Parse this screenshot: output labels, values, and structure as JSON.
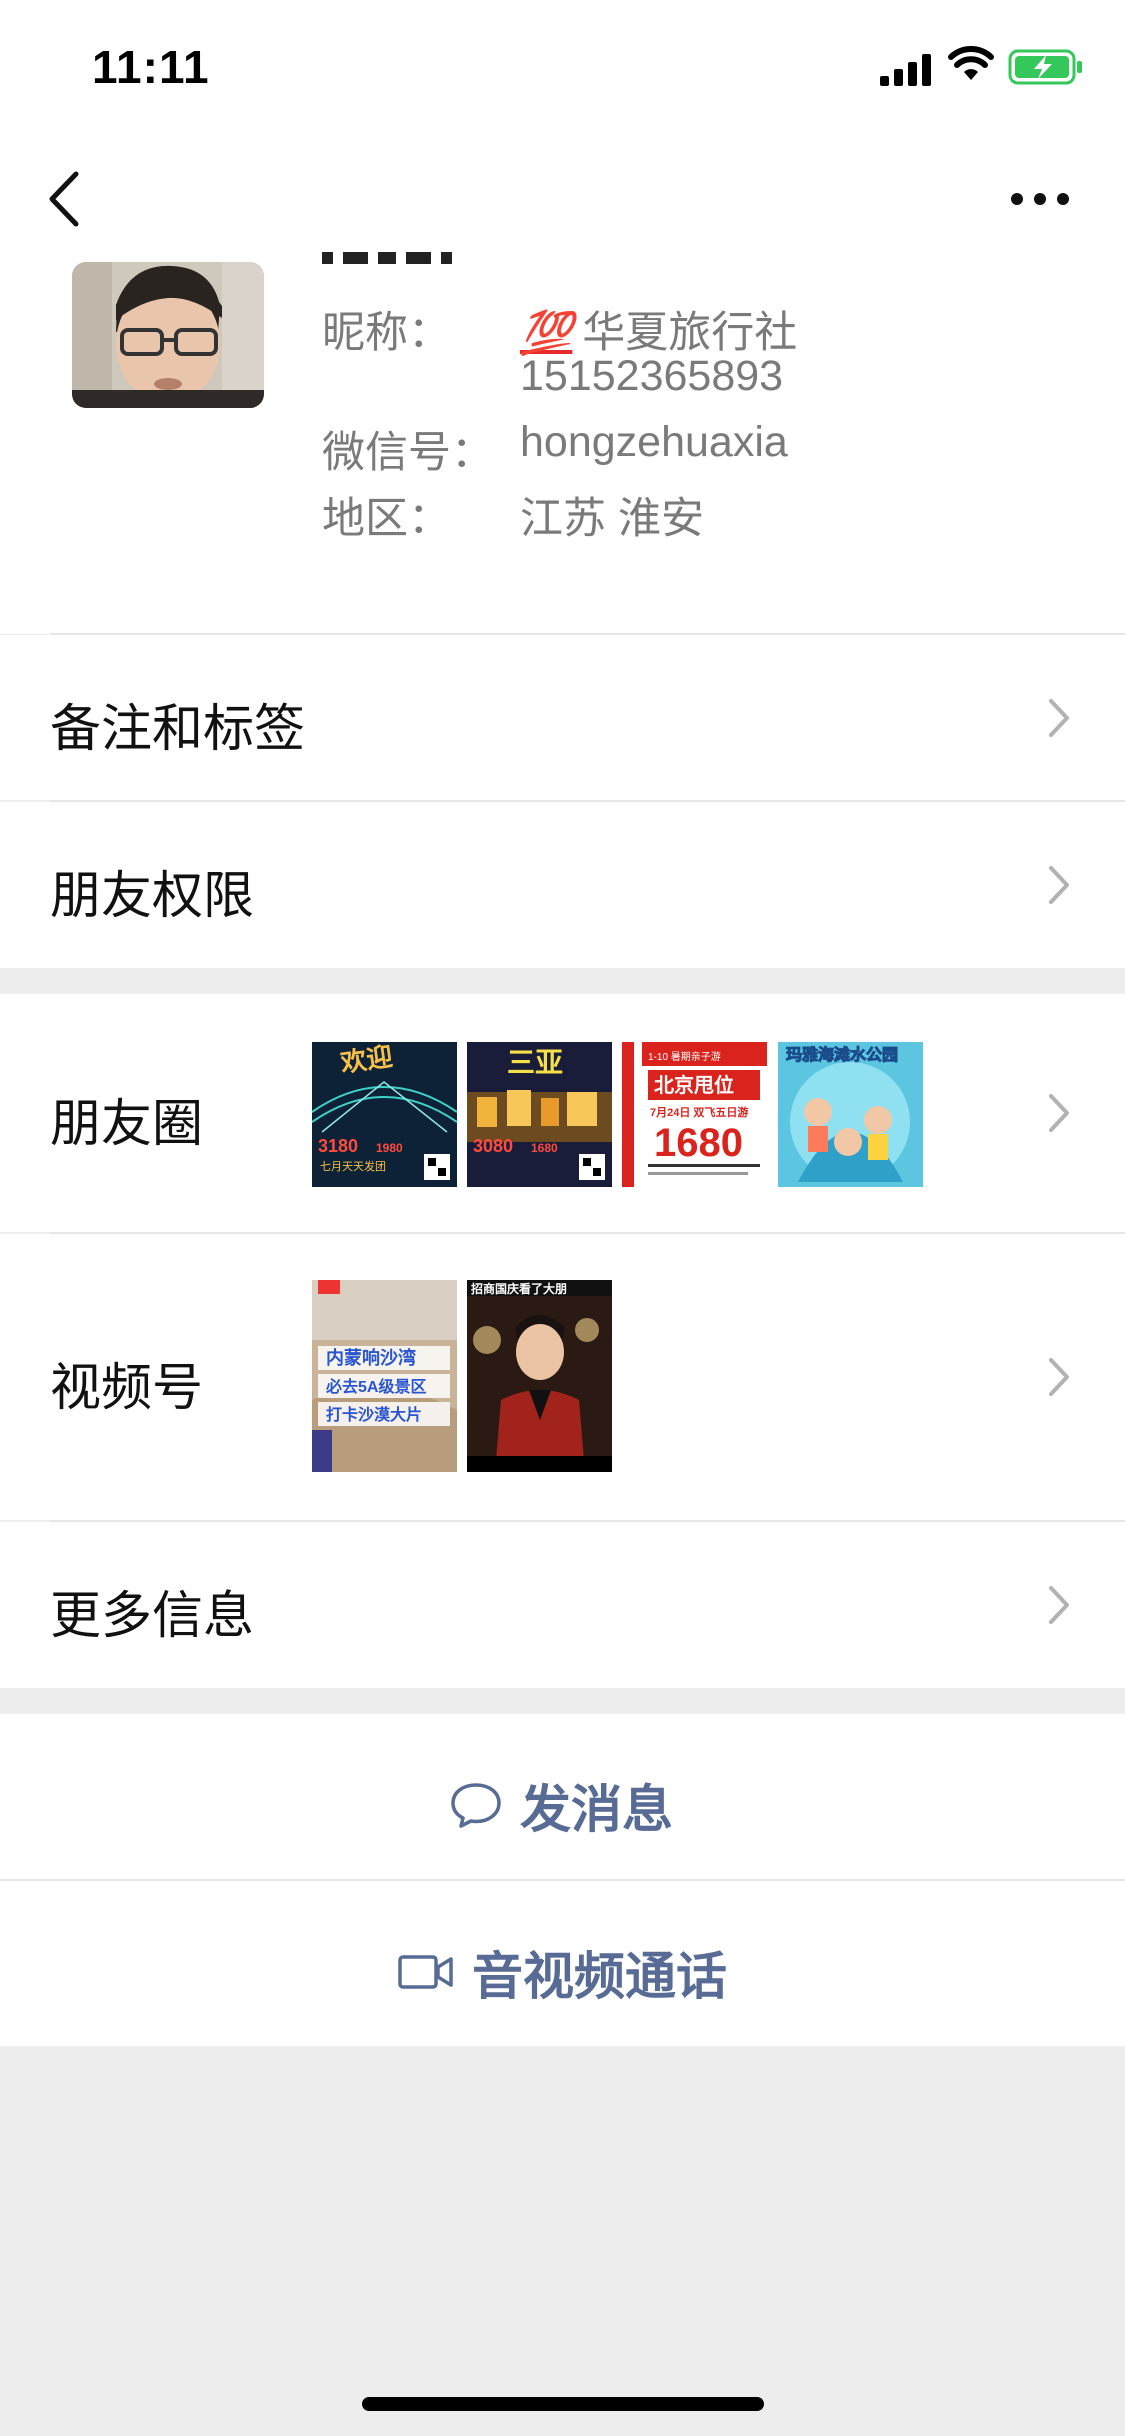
{
  "status_bar": {
    "time": "11:11"
  },
  "nav": {
    "back_icon": "chevron-left-icon",
    "more_icon": "ellipsis-icon"
  },
  "profile": {
    "nickname_label": "昵称：",
    "nickname_emoji": "💯",
    "nickname_value": "华夏旅行社",
    "nickname_line2": "15152365893",
    "wechat_id_label": "微信号：",
    "wechat_id_value": "hongzehuaxia",
    "region_label": "地区：",
    "region_value": "江苏 淮安"
  },
  "rows": {
    "remarks_tags": "备注和标签",
    "friend_permissions": "朋友权限",
    "moments": "朋友圈",
    "channels": "视频号",
    "more_info": "更多信息"
  },
  "moments_thumbs": [
    {
      "big": "欢迎",
      "price": "3180",
      "price2": "1980",
      "caption": "七月天天发团"
    },
    {
      "big": "三亚",
      "price": "3080",
      "price2": "1680",
      "caption": ""
    },
    {
      "top": "1-10 暑期亲子游",
      "title": "北京甩位",
      "date": "7月24日 双飞五日游",
      "price": "1680"
    },
    {
      "title": "玛雅海滩水公园"
    }
  ],
  "channels_thumbs": [
    {
      "line1": "内蒙响沙湾",
      "line2": "必去5A级景区",
      "line3": "打卡沙漠大片"
    },
    {
      "title": "招商国庆看了大朋"
    }
  ],
  "actions": {
    "message": "发消息",
    "av_call": "音视频通话"
  },
  "colors": {
    "accent": "#576b95",
    "battery": "#34c759",
    "emoji": "#e42b2b"
  }
}
